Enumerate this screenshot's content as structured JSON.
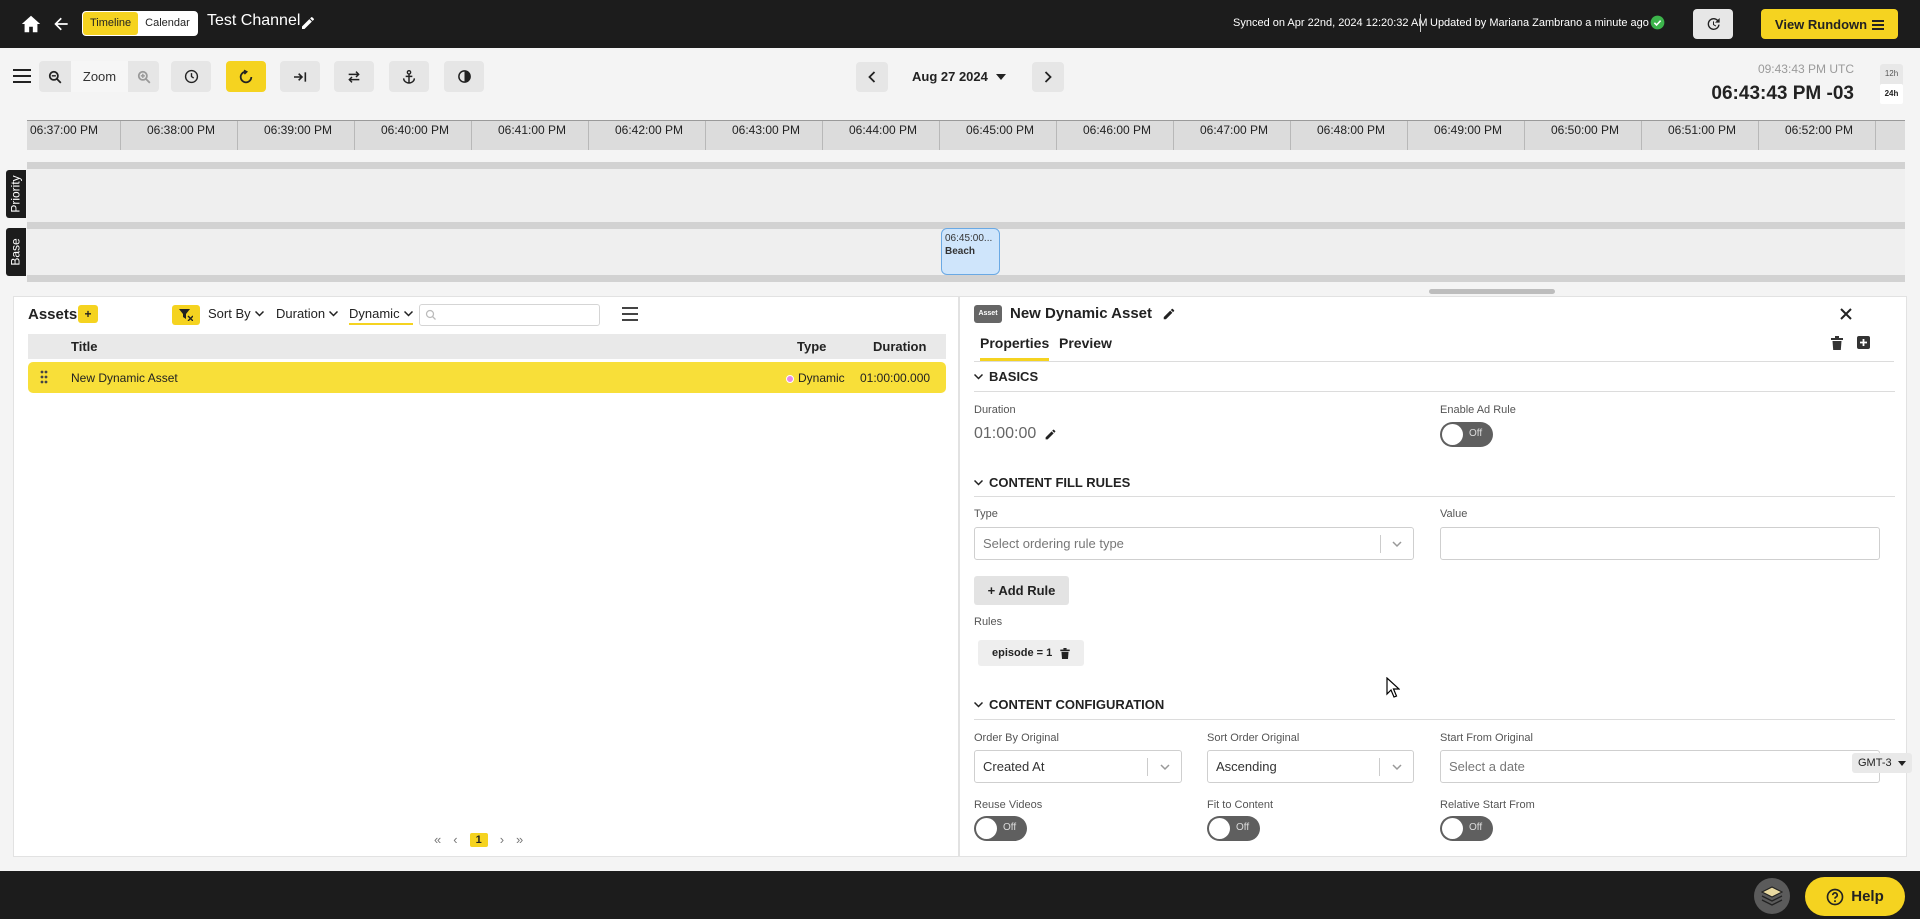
{
  "topbar": {
    "view_toggle": [
      "Timeline",
      "Calendar"
    ],
    "active_view": "Timeline",
    "channel_title": "Test Channel",
    "sync_text": "Synced on Apr 22nd, 2024 12:20:32 AM",
    "updated_text": "Updated by Mariana Zambrano a minute ago",
    "status_color": "#3cb44b",
    "view_rundown_label": "View Rundown"
  },
  "toolbar": {
    "zoom_label": "Zoom",
    "date": "Aug 27 2024",
    "utc_time": "09:43:43 PM UTC",
    "local_time": "06:43:43 PM -03",
    "hour_formats": [
      "12h",
      "24h"
    ],
    "active_hour_format": "24h"
  },
  "timeline": {
    "ticks": [
      "06:37:00 PM",
      "06:38:00 PM",
      "06:39:00 PM",
      "06:40:00 PM",
      "06:41:00 PM",
      "06:42:00 PM",
      "06:43:00 PM",
      "06:44:00 PM",
      "06:45:00 PM",
      "06:46:00 PM",
      "06:47:00 PM",
      "06:48:00 PM",
      "06:49:00 PM",
      "06:50:00 PM",
      "06:51:00 PM",
      "06:52:00 PM"
    ],
    "tracks": [
      "Priority",
      "Base"
    ],
    "event": {
      "time": "06:45:00...",
      "name": "Beach"
    }
  },
  "assets": {
    "title": "Assets",
    "add_label": "+",
    "sort_by": "Sort By",
    "duration_filter": "Duration",
    "type_filter": "Dynamic",
    "search_placeholder": "",
    "columns": {
      "title": "Title",
      "type": "Type",
      "duration": "Duration"
    },
    "rows": [
      {
        "title": "New Dynamic Asset",
        "type": "Dynamic",
        "duration": "01:00:00.000"
      }
    ],
    "pager": {
      "first": "«",
      "prev": "‹",
      "current": "1",
      "next": "›",
      "last": "»"
    }
  },
  "properties": {
    "badge": "Asset",
    "title": "New Dynamic Asset",
    "tabs": [
      "Properties",
      "Preview"
    ],
    "sections": {
      "basics": "BASICS",
      "content_fill_rules": "CONTENT FILL RULES",
      "content_configuration": "CONTENT CONFIGURATION"
    },
    "duration_label": "Duration",
    "duration_value": "01:00:00",
    "enable_ad_rule_label": "Enable Ad Rule",
    "toggle_off": "Off",
    "type_label": "Type",
    "type_placeholder": "Select ordering rule type",
    "value_label": "Value",
    "add_rule_label": "+ Add Rule",
    "rules_label": "Rules",
    "rules": [
      "episode = 1"
    ],
    "order_by_label": "Order By Original",
    "order_by_value": "Created At",
    "sort_order_label": "Sort Order Original",
    "sort_order_value": "Ascending",
    "start_from_label": "Start From Original",
    "start_from_placeholder": "Select a date",
    "timezone": "GMT-3",
    "reuse_videos_label": "Reuse Videos",
    "fit_to_content_label": "Fit to Content",
    "relative_start_label": "Relative Start From"
  },
  "bottombar": {
    "help_label": "Help"
  },
  "colors": {
    "accent": "#f5d320",
    "dark": "#1c1c1c",
    "event_fill": "#cfe5fb",
    "dynamic_dot": "#e58ce8"
  }
}
